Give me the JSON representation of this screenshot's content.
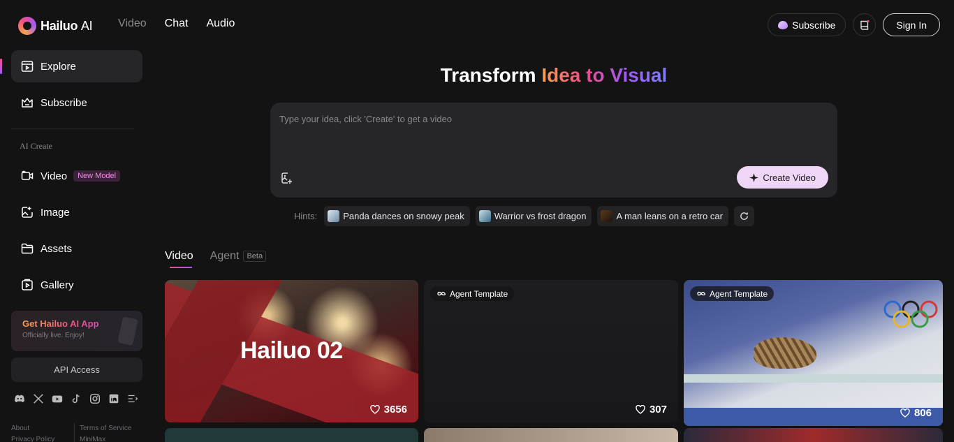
{
  "brand": {
    "name": "Hailuo",
    "suffix": "AI"
  },
  "topnav": {
    "items": [
      "Video",
      "Chat",
      "Audio"
    ]
  },
  "header": {
    "subscribe_label": "Subscribe",
    "signin_label": "Sign In"
  },
  "sidebar": {
    "items": [
      {
        "label": "Explore"
      },
      {
        "label": "Subscribe"
      }
    ],
    "section_label": "AI Create",
    "create_items": [
      {
        "label": "Video",
        "badge": "New Model"
      },
      {
        "label": "Image"
      },
      {
        "label": "Assets"
      },
      {
        "label": "Gallery"
      }
    ],
    "app_card": {
      "title": "Get Hailuo AI App",
      "subtitle": "Officially live. Enjoy!"
    },
    "api_label": "API Access",
    "footer": {
      "col1": [
        "About",
        "Privacy Policy"
      ],
      "col2": [
        "Terms of Service",
        "MiniMax"
      ]
    }
  },
  "hero": {
    "title_plain": "Transform ",
    "title_gradient": "Idea to Visual"
  },
  "prompt": {
    "placeholder": "Type your idea, click 'Create' to get a video",
    "create_label": "Create Video"
  },
  "hints": {
    "label": "Hints:",
    "items": [
      "Panda dances on snowy peak",
      "Warrior vs frost dragon",
      "A man leans on a retro car"
    ]
  },
  "tabs": {
    "video": "Video",
    "agent": "Agent",
    "beta": "Beta"
  },
  "cards": [
    {
      "overlay": "Hailuo 02",
      "likes": "3656"
    },
    {
      "tag": "Agent Template",
      "likes": "307"
    },
    {
      "tag": "Agent Template",
      "likes": "806"
    }
  ]
}
